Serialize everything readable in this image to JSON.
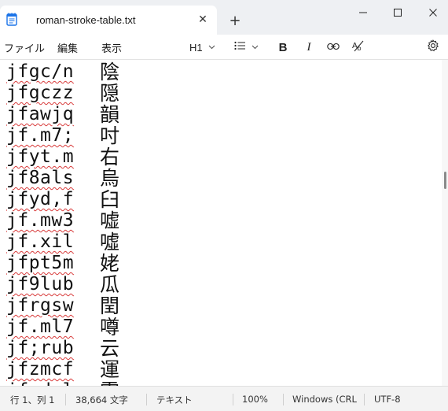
{
  "window": {
    "tab_title": "roman-stroke-table.txt",
    "new_tab_label": "+",
    "close_tab_label": "✕"
  },
  "menu": {
    "file": "ファイル",
    "edit": "編集",
    "view": "表示"
  },
  "toolbar": {
    "heading": "H1",
    "list_icon": "list-icon",
    "bold": "B",
    "italic": "I",
    "link_icon": "link-icon",
    "clear_format_icon": "clear-formatting-icon",
    "settings_icon": "gear-icon"
  },
  "lines": [
    {
      "code": "jfgc/n",
      "kanji": "陰"
    },
    {
      "code": "jfgczz",
      "kanji": "隠"
    },
    {
      "code": "jfawjq",
      "kanji": "韻"
    },
    {
      "code": "jf.m7;",
      "kanji": "吋"
    },
    {
      "code": "jfyt.m",
      "kanji": "右"
    },
    {
      "code": "jf8als",
      "kanji": "烏"
    },
    {
      "code": "jfyd,f",
      "kanji": "臼"
    },
    {
      "code": "jf.mw3",
      "kanji": "嘘"
    },
    {
      "code": "jf.xil",
      "kanji": "噓"
    },
    {
      "code": "jfpt5m",
      "kanji": "姥"
    },
    {
      "code": "jf9lub",
      "kanji": "瓜"
    },
    {
      "code": "jfrgsw",
      "kanji": "閏"
    },
    {
      "code": "jf.ml7",
      "kanji": "噂"
    },
    {
      "code": "jf;rub",
      "kanji": "云"
    },
    {
      "code": "jfzmcf",
      "kanji": "運"
    },
    {
      "code": "jf.dul",
      "kanji": "雲"
    }
  ],
  "status": {
    "position": "行 1、列 1",
    "chars": "38,664 文字",
    "format": "テキスト",
    "zoom": "100%",
    "line_ending": "Windows (CRLF",
    "encoding": "UTF-8"
  },
  "colors": {
    "accent": "#1a73e8",
    "spellcheck": "#d83b3b"
  }
}
